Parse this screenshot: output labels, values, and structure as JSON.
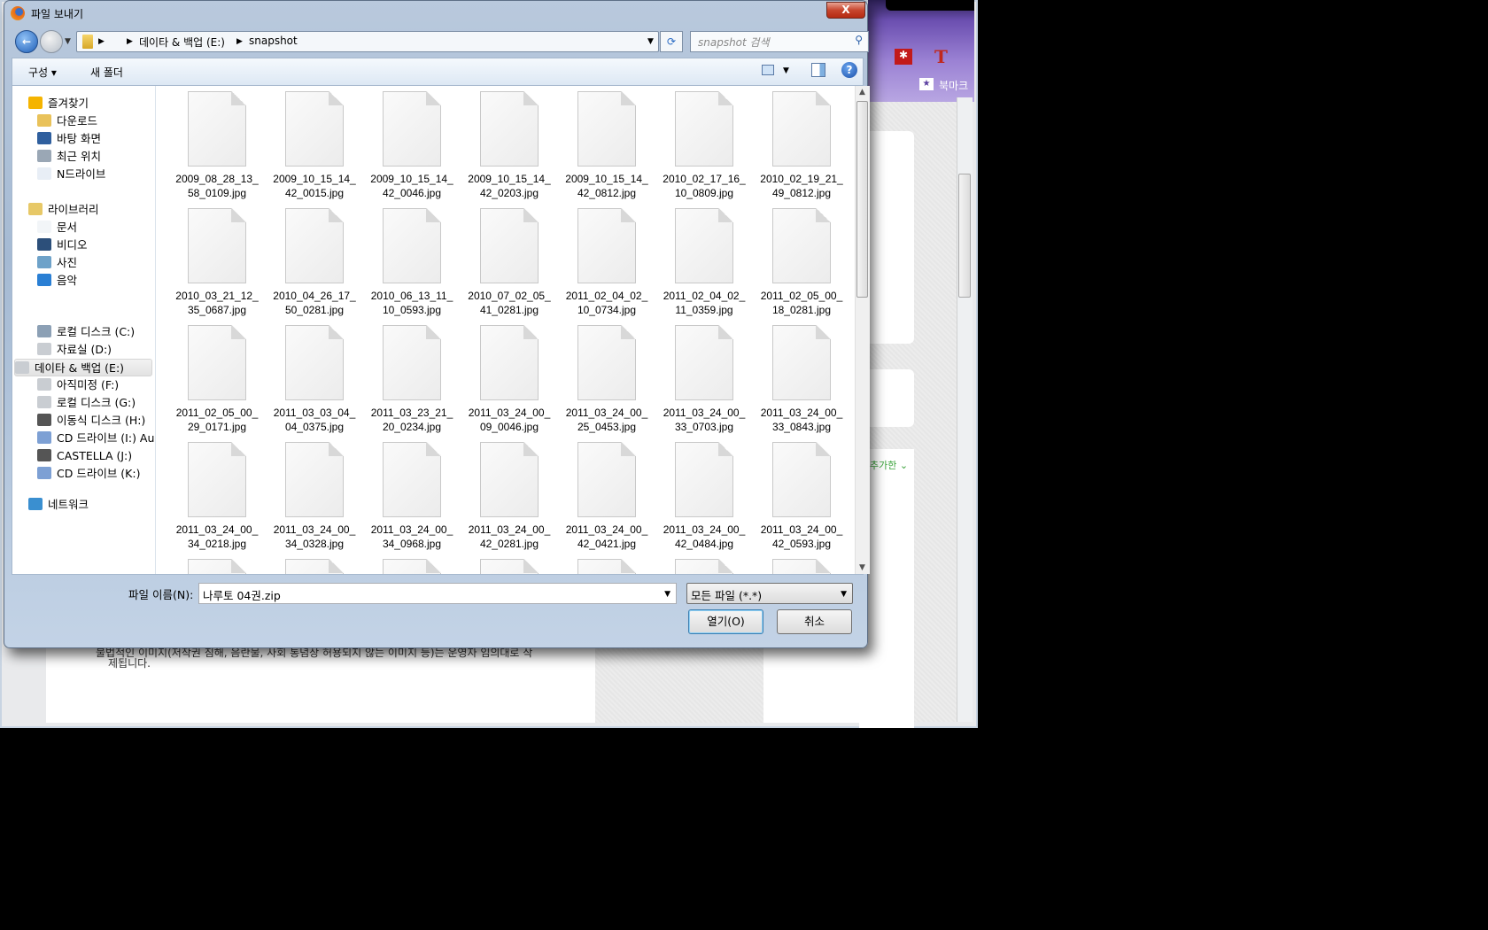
{
  "browser": {
    "bookmark_label": "북마크",
    "added_label": "추가한 ⌄",
    "notice_line1": "불법적인 이미지(저작권 침해, 음란물, 사회 통념상 허용되지 않는 이미지 등)는 운영자 임의대로 삭",
    "notice_line2": "제됩니다.",
    "accent": "#7b5fc4"
  },
  "dialog": {
    "title": "파일 보내기",
    "close_label": "X",
    "address": {
      "crumbs": [
        "데이타 & 백업 (E:)",
        "snapshot"
      ]
    },
    "search_placeholder": "snapshot 검색",
    "toolbar": {
      "organize": "구성 ▾",
      "new_folder": "새 폴더"
    },
    "sidebar": [
      {
        "label": "즐겨찾기",
        "icon": "star-icon",
        "indent": 0,
        "group": true
      },
      {
        "label": "다운로드",
        "icon": "downloads-folder-icon",
        "indent": 1
      },
      {
        "label": "바탕 화면",
        "icon": "desktop-icon",
        "indent": 1
      },
      {
        "label": "최근 위치",
        "icon": "recent-places-icon",
        "indent": 1
      },
      {
        "label": "N드라이브",
        "icon": "ndrive-icon",
        "indent": 1
      },
      {
        "label": "라이브러리",
        "icon": "library-icon",
        "indent": 0,
        "group": true
      },
      {
        "label": "문서",
        "icon": "documents-icon",
        "indent": 1
      },
      {
        "label": "비디오",
        "icon": "video-icon",
        "indent": 1
      },
      {
        "label": "사진",
        "icon": "pictures-icon",
        "indent": 1
      },
      {
        "label": "음악",
        "icon": "music-icon",
        "indent": 1
      },
      {
        "label": "로컬 디스크 (C:)",
        "icon": "system-drive-icon",
        "indent": 1
      },
      {
        "label": "자료실 (D:)",
        "icon": "drive-icon",
        "indent": 1
      },
      {
        "label": "데이타 & 백업 (E:)",
        "icon": "drive-icon",
        "indent": 1,
        "selected": true
      },
      {
        "label": "아직미정 (F:)",
        "icon": "drive-icon",
        "indent": 1
      },
      {
        "label": "로컬 디스크 (G:)",
        "icon": "drive-icon",
        "indent": 1
      },
      {
        "label": "이동식 디스크 (H:)",
        "icon": "removable-drive-icon",
        "indent": 1
      },
      {
        "label": "CD 드라이브 (I:) Au",
        "icon": "cd-drive-icon",
        "indent": 1
      },
      {
        "label": "CASTELLA (J:)",
        "icon": "removable-drive-icon",
        "indent": 1
      },
      {
        "label": "CD 드라이브 (K:)",
        "icon": "cd-drive-icon",
        "indent": 1
      },
      {
        "label": "네트워크",
        "icon": "network-icon",
        "indent": 0,
        "group": true
      }
    ],
    "files": [
      [
        "2009_08_28_13_",
        "58_0109.jpg"
      ],
      [
        "2009_10_15_14_",
        "42_0015.jpg"
      ],
      [
        "2009_10_15_14_",
        "42_0046.jpg"
      ],
      [
        "2009_10_15_14_",
        "42_0203.jpg"
      ],
      [
        "2009_10_15_14_",
        "42_0812.jpg"
      ],
      [
        "2010_02_17_16_",
        "10_0809.jpg"
      ],
      [
        "2010_02_19_21_",
        "49_0812.jpg"
      ],
      [
        "2010_03_21_12_",
        "35_0687.jpg"
      ],
      [
        "2010_04_26_17_",
        "50_0281.jpg"
      ],
      [
        "2010_06_13_11_",
        "10_0593.jpg"
      ],
      [
        "2010_07_02_05_",
        "41_0281.jpg"
      ],
      [
        "2011_02_04_02_",
        "10_0734.jpg"
      ],
      [
        "2011_02_04_02_",
        "11_0359.jpg"
      ],
      [
        "2011_02_05_00_",
        "18_0281.jpg"
      ],
      [
        "2011_02_05_00_",
        "29_0171.jpg"
      ],
      [
        "2011_03_03_04_",
        "04_0375.jpg"
      ],
      [
        "2011_03_23_21_",
        "20_0234.jpg"
      ],
      [
        "2011_03_24_00_",
        "09_0046.jpg"
      ],
      [
        "2011_03_24_00_",
        "25_0453.jpg"
      ],
      [
        "2011_03_24_00_",
        "33_0703.jpg"
      ],
      [
        "2011_03_24_00_",
        "33_0843.jpg"
      ],
      [
        "2011_03_24_00_",
        "34_0218.jpg"
      ],
      [
        "2011_03_24_00_",
        "34_0328.jpg"
      ],
      [
        "2011_03_24_00_",
        "34_0968.jpg"
      ],
      [
        "2011_03_24_00_",
        "42_0281.jpg"
      ],
      [
        "2011_03_24_00_",
        "42_0421.jpg"
      ],
      [
        "2011_03_24_00_",
        "42_0484.jpg"
      ],
      [
        "2011_03_24_00_",
        "42_0593.jpg"
      ]
    ],
    "filename_label": "파일 이름(N):",
    "filename_value": "나루토 04권.zip",
    "filter_value": "모든 파일 (*.*)",
    "open_label": "열기(O)",
    "cancel_label": "취소"
  }
}
